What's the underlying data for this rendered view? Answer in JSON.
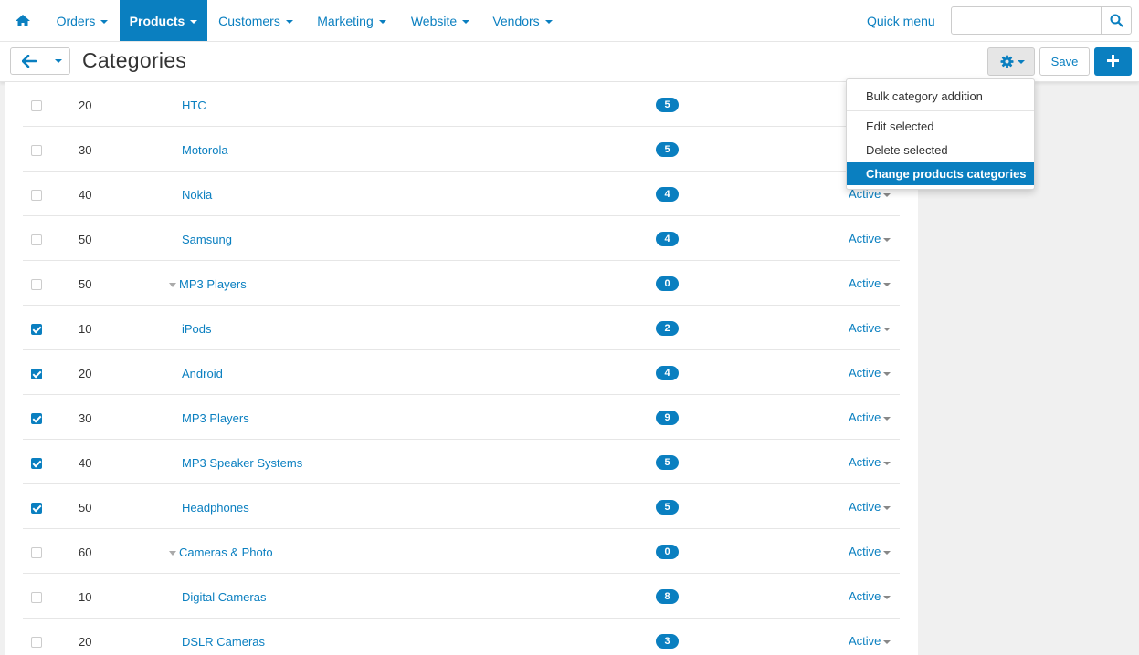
{
  "nav": {
    "items": [
      {
        "label": "Orders",
        "active": false
      },
      {
        "label": "Products",
        "active": true
      },
      {
        "label": "Customers",
        "active": false
      },
      {
        "label": "Marketing",
        "active": false
      },
      {
        "label": "Website",
        "active": false
      },
      {
        "label": "Vendors",
        "active": false
      }
    ],
    "quick_menu": "Quick menu",
    "search_value": "",
    "home_icon": "home-icon",
    "search_icon": "search-icon"
  },
  "toolbar": {
    "title": "Categories",
    "save_label": "Save",
    "back_icon": "arrow-left-icon",
    "gear_icon": "gear-icon",
    "add_icon": "plus-icon"
  },
  "dropdown": {
    "items": [
      {
        "label": "Bulk category addition",
        "active": false
      },
      {
        "label": "Edit selected",
        "active": false
      },
      {
        "label": "Delete selected",
        "active": false
      },
      {
        "label": "Change products categories",
        "active": true
      }
    ]
  },
  "rows": [
    {
      "checked": false,
      "position": "20",
      "name": "HTC",
      "parent": false,
      "count": "5",
      "status": ""
    },
    {
      "checked": false,
      "position": "30",
      "name": "Motorola",
      "parent": false,
      "count": "5",
      "status": ""
    },
    {
      "checked": false,
      "position": "40",
      "name": "Nokia",
      "parent": false,
      "count": "4",
      "status": "Active"
    },
    {
      "checked": false,
      "position": "50",
      "name": "Samsung",
      "parent": false,
      "count": "4",
      "status": "Active"
    },
    {
      "checked": false,
      "position": "50",
      "name": "MP3 Players",
      "parent": true,
      "count": "0",
      "status": "Active"
    },
    {
      "checked": true,
      "position": "10",
      "name": "iPods",
      "parent": false,
      "count": "2",
      "status": "Active"
    },
    {
      "checked": true,
      "position": "20",
      "name": "Android",
      "parent": false,
      "count": "4",
      "status": "Active"
    },
    {
      "checked": true,
      "position": "30",
      "name": "MP3 Players",
      "parent": false,
      "count": "9",
      "status": "Active"
    },
    {
      "checked": true,
      "position": "40",
      "name": "MP3 Speaker Systems",
      "parent": false,
      "count": "5",
      "status": "Active"
    },
    {
      "checked": true,
      "position": "50",
      "name": "Headphones",
      "parent": false,
      "count": "5",
      "status": "Active"
    },
    {
      "checked": false,
      "position": "60",
      "name": "Cameras & Photo",
      "parent": true,
      "count": "0",
      "status": "Active"
    },
    {
      "checked": false,
      "position": "10",
      "name": "Digital Cameras",
      "parent": false,
      "count": "8",
      "status": "Active"
    },
    {
      "checked": false,
      "position": "20",
      "name": "DSLR Cameras",
      "parent": false,
      "count": "3",
      "status": "Active"
    }
  ],
  "colors": {
    "accent": "#0a7fc0",
    "page_bg": "#f0f0f0"
  }
}
